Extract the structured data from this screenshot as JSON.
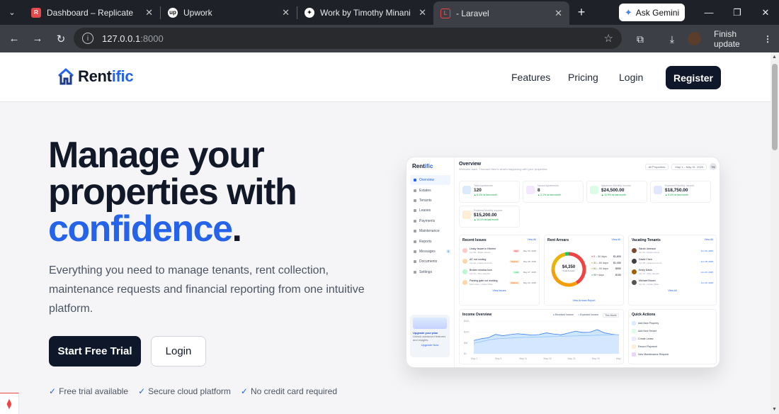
{
  "browser": {
    "tabs": [
      {
        "title": "Dashboard – Replicate",
        "favicon": "replicate-icon",
        "fav_color": "#e5484d",
        "fav_text": "R"
      },
      {
        "title": "Upwork",
        "favicon": "upwork-icon",
        "fav_color": "#111111",
        "fav_text": "up"
      },
      {
        "title": "Work by Timothy Minani",
        "favicon": "sparkle-icon",
        "fav_color": "#111111",
        "fav_text": "✦"
      },
      {
        "title": "- Laravel",
        "favicon": "laravel-icon",
        "fav_color": "#ef4444",
        "fav_text": "L"
      }
    ],
    "new_tab": "+",
    "gemini_label": "Ask Gemini",
    "url_host": "127.0.0.1",
    "url_port": ":8000",
    "finish_update_label": "Finish update"
  },
  "nav": {
    "logo_prefix": "Rent",
    "logo_suffix": "ific",
    "links": [
      "Features",
      "Pricing",
      "Login"
    ],
    "register_label": "Register"
  },
  "hero": {
    "title_line1": "Manage your",
    "title_line2": "properties with",
    "title_highlight": "confidence",
    "title_period": ".",
    "subtitle": "Everything you need to manage tenants, rent collection, maintenance requests and financial reporting from one intuitive platform.",
    "primary_cta": "Start Free Trial",
    "secondary_cta": "Login",
    "features": [
      "Free trial available",
      "Secure cloud platform",
      "No credit card required"
    ],
    "check_glyph": "✓"
  },
  "mockup": {
    "logo_prefix": "Rent",
    "logo_suffix": "ific",
    "sidebar": [
      {
        "label": "Overview",
        "active": true
      },
      {
        "label": "Estates"
      },
      {
        "label": "Tenants"
      },
      {
        "label": "Leases"
      },
      {
        "label": "Payments"
      },
      {
        "label": "Maintenance"
      },
      {
        "label": "Reports"
      },
      {
        "label": "Messages",
        "count": "3"
      },
      {
        "label": "Documents"
      },
      {
        "label": "Settings"
      }
    ],
    "upgrade_title": "Upgrade your plan",
    "upgrade_text": "Unlock advanced features and insights",
    "upgrade_link": "Upgrade Now",
    "heading": "Overview",
    "heading_sub": "Welcome back, Thomas! Here's what's happening with your properties",
    "filter_label": "All Properties",
    "date_range": "May 1 – May 31, 2025",
    "user_initials": "TM",
    "stats": [
      {
        "label": "Total Apartments",
        "value": "120",
        "trend": "▲ 8.4% vs last month",
        "color": "#dbeafe"
      },
      {
        "label": "Vacant Apartments",
        "value": "8",
        "trend": "▲ 2.1% vs last month",
        "color": "#f3e8ff"
      },
      {
        "label": "Maximum Monthly Income",
        "value": "$24,500.00",
        "trend": "▲ 12.5% vs last month",
        "color": "#dcfce7"
      },
      {
        "label": "Expected Monthly Income",
        "value": "$18,750.00",
        "trend": "▲ 8.3% vs last month",
        "color": "#e0e7ff"
      },
      {
        "label": "Realized Monthly Income",
        "value": "$15,200.00",
        "trend": "▲ 10.1% vs last month",
        "color": "#ffedd5"
      }
    ],
    "view_all": "View All",
    "issues_title": "Recent Issues",
    "issues": [
      {
        "title": "Leaky faucet in Kitchen",
        "sub": "Apt 3B • Maple House",
        "badge": "High",
        "badge_bg": "#fee2e2",
        "badge_fg": "#dc2626",
        "date": "May 30, 2025",
        "dot": "#fecaca"
      },
      {
        "title": "AC not cooling",
        "sub": "Apt 4A • Oakwood Arms",
        "badge": "Medium",
        "badge_bg": "#ffedd5",
        "badge_fg": "#ea580c",
        "date": "May 28, 2025",
        "dot": "#fed7aa"
      },
      {
        "title": "Broken window lock",
        "sub": "Apt 2C • Pine Heights",
        "badge": "Low",
        "badge_bg": "#dcfce7",
        "badge_fg": "#16a34a",
        "date": "May 27, 2025",
        "dot": "#bbf7d0"
      },
      {
        "title": "Parking gate not working",
        "sub": "Main Gate • Cedar Villas",
        "badge": "Medium",
        "badge_bg": "#ffedd5",
        "badge_fg": "#ea580c",
        "date": "May 26, 2025",
        "dot": "#fed7aa"
      }
    ],
    "issues_footer": "View Issues",
    "arrears_title": "Rent Arrears",
    "arrears_total": "$4,350",
    "arrears_total_label": "Total Arrears",
    "arrears": [
      {
        "label": "0 – 30 days",
        "value": "$1,800",
        "color": "#ef4444",
        "share": 0.414
      },
      {
        "label": "31 – 60 days",
        "value": "$1,450",
        "color": "#f59e0b",
        "share": 0.333
      },
      {
        "label": "61 – 90 days",
        "value": "$950",
        "color": "#eab308",
        "share": 0.218
      },
      {
        "label": "90+ days",
        "value": "$150",
        "color": "#22c55e",
        "share": 0.035
      }
    ],
    "arrears_footer": "View Arrears Report",
    "tenants_title": "Vacating Tenants",
    "tenants": [
      {
        "name": "Sarah Johnson",
        "sub": "Apt 3A • Maple House",
        "date": "Jun 15, 2025"
      },
      {
        "name": "David Chen",
        "sub": "Apt 2B • Oakwood Arms",
        "date": "Jun 18, 2025"
      },
      {
        "name": "Emily Davis",
        "sub": "Apt 1C • Pine Heights",
        "date": "Jun 20, 2025"
      },
      {
        "name": "Michael Brown",
        "sub": "Apt 4C • Cedar Villas",
        "date": "Jun 30, 2025"
      }
    ],
    "tenants_footer": "View All",
    "income_title": "Income Overview",
    "income_legend": [
      "Received Income",
      "Expected Income"
    ],
    "income_period": "This Month",
    "income_y": [
      "$15K",
      "$10K",
      "$5K",
      "$0"
    ],
    "income_x": [
      "May 1",
      "May 6",
      "May 11",
      "May 16",
      "May 21",
      "May 26",
      "May 31"
    ],
    "income_received": [
      6.1,
      6.9,
      7.4,
      8.9,
      8.3,
      8.8,
      9.2,
      8.9,
      8.6,
      8.8,
      9.6,
      9.1,
      8.7,
      9.5,
      10.4,
      9.8,
      9.9,
      11.1,
      9.6,
      9.0,
      8.6
    ],
    "income_expected": [
      4.8,
      5.5,
      6.3,
      6.8,
      7.0,
      7.2,
      7.4,
      7.5,
      7.6,
      7.7,
      7.8,
      7.9,
      8.0,
      8.1,
      8.2,
      8.3,
      8.4,
      8.5,
      8.6,
      8.7,
      8.8
    ],
    "quick_title": "Quick Actions",
    "quick": [
      {
        "label": "Add New Property",
        "color": "#dbeafe"
      },
      {
        "label": "Add New Tenant",
        "color": "#dcfce7"
      },
      {
        "label": "Create Lease",
        "color": "#ede9fe"
      },
      {
        "label": "Record Payment",
        "color": "#ffedd5"
      },
      {
        "label": "New Maintenance Request",
        "color": "#e9d5ff"
      }
    ]
  }
}
